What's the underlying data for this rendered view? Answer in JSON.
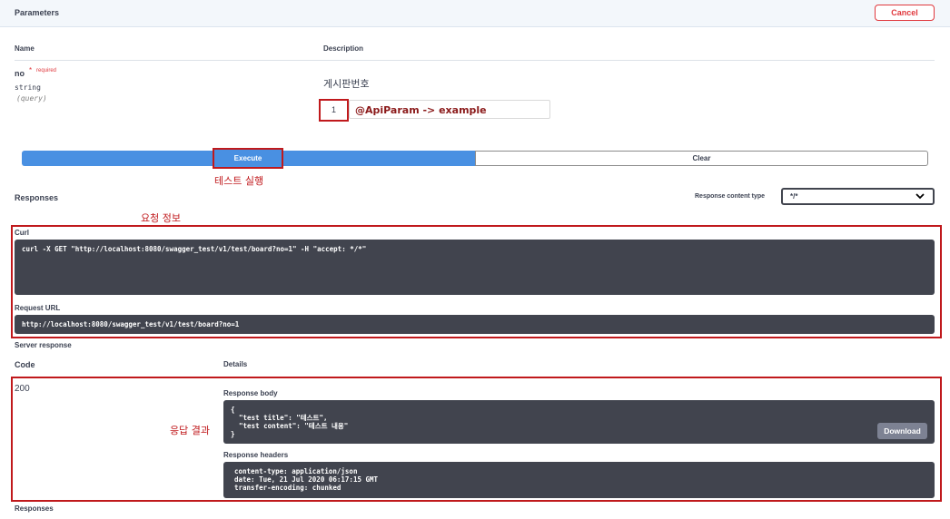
{
  "parameters": {
    "title": "Parameters",
    "cancel_label": "Cancel",
    "name_head": "Name",
    "desc_head": "Description",
    "param": {
      "name": "no",
      "required_star": "*",
      "required_label": "required",
      "type": "string",
      "in": "(query)",
      "description": "게시판번호",
      "value": "1",
      "annotation": "@ApiParam -> example"
    }
  },
  "actions": {
    "execute_label": "Execute",
    "clear_label": "Clear",
    "execute_annotation": "테스트 실행"
  },
  "responses": {
    "title": "Responses",
    "content_type_label": "Response content type",
    "content_type_value": "*/*",
    "request_annotation": "요청 정보",
    "curl_label": "Curl",
    "curl_command": "curl -X GET \"http://localhost:8080/swagger_test/v1/test/board?no=1\" -H \"accept: */*\"",
    "request_url_label": "Request URL",
    "request_url": "http://localhost:8080/swagger_test/v1/test/board?no=1",
    "server_response_label": "Server response",
    "code_head": "Code",
    "details_head": "Details",
    "status_code": "200",
    "response_annotation": "응답 결과",
    "response_body_label": "Response body",
    "response_body": "{\n  \"test title\": \"테스트\",\n  \"test content\": \"테스트 내용\"\n}",
    "download_label": "Download",
    "response_headers_label": "Response headers",
    "response_headers": "content-type: application/json\ndate: Tue, 21 Jul 2020 06:17:15 GMT\ntransfer-encoding: chunked",
    "bottom_title": "Responses"
  },
  "colors": {
    "execute_blue": "#4990e2",
    "annotation_red": "#c0191c",
    "code_block": "#41444e"
  }
}
